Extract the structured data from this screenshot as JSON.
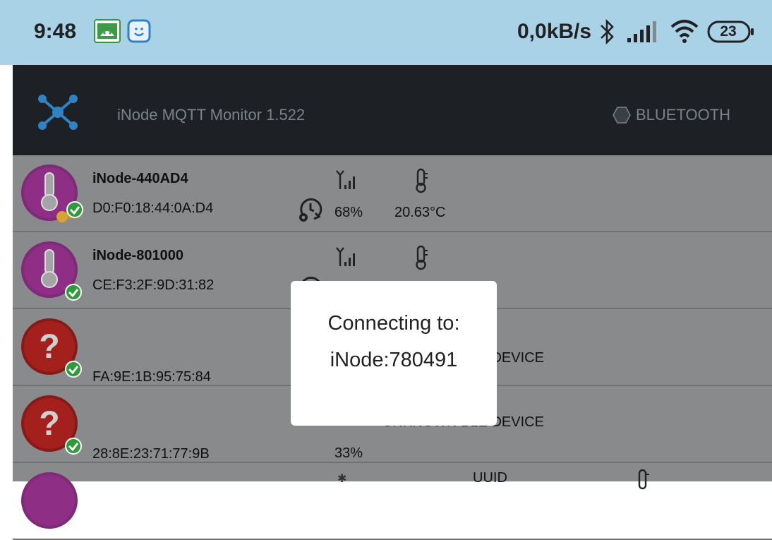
{
  "status_bar": {
    "time": "9:48",
    "network_speed": "0,0kB/s",
    "battery": "23",
    "icons": [
      "android-notification-icon",
      "face-notification-icon",
      "bluetooth-icon",
      "signal-icon",
      "wifi-icon",
      "battery-icon"
    ]
  },
  "toolbar": {
    "title": "iNode MQTT Monitor 1.522",
    "mode_label": "BLUETOOTH",
    "logo_icon": "network-hub-icon"
  },
  "devices": [
    {
      "name": "iNode-440AD4",
      "mac": "D0:F0:18:44:0A:D4",
      "signal": "68%",
      "temperature": "20.63°C",
      "icon": "thermometer-device-icon",
      "badge": "key-check-badge"
    },
    {
      "name": "iNode-801000",
      "mac": "CE:F3:2F:9D:31:82",
      "icon": "thermometer-device-icon",
      "badge": "check-badge"
    },
    {
      "name": "",
      "mac": "FA:9E:1B:95:75:84",
      "status_text": "UNKNOWN BLE DEVICE",
      "icon": "unknown-device-icon",
      "badge": "check-badge"
    },
    {
      "name": "",
      "mac": "28:8E:23:71:77:9B",
      "signal": "33%",
      "status_text": "UNKNOWN BLE DEVICE",
      "icon": "unknown-device-icon",
      "badge": "check-badge"
    },
    {
      "name": "",
      "mac": "",
      "status_text": "UUID",
      "icon": "thermometer-device-icon"
    }
  ],
  "dialog": {
    "line1": "Connecting to:",
    "line2": "iNode:780491"
  },
  "colors": {
    "status_bar_bg": "#a9d2e6",
    "toolbar_bg": "#1d2125",
    "list_dimmed_bg": "#888a8b",
    "accent_blue": "#2f83c4",
    "device_purple": "#8e2e85",
    "unknown_red": "#a3201d",
    "check_green": "#2e9a3a"
  }
}
